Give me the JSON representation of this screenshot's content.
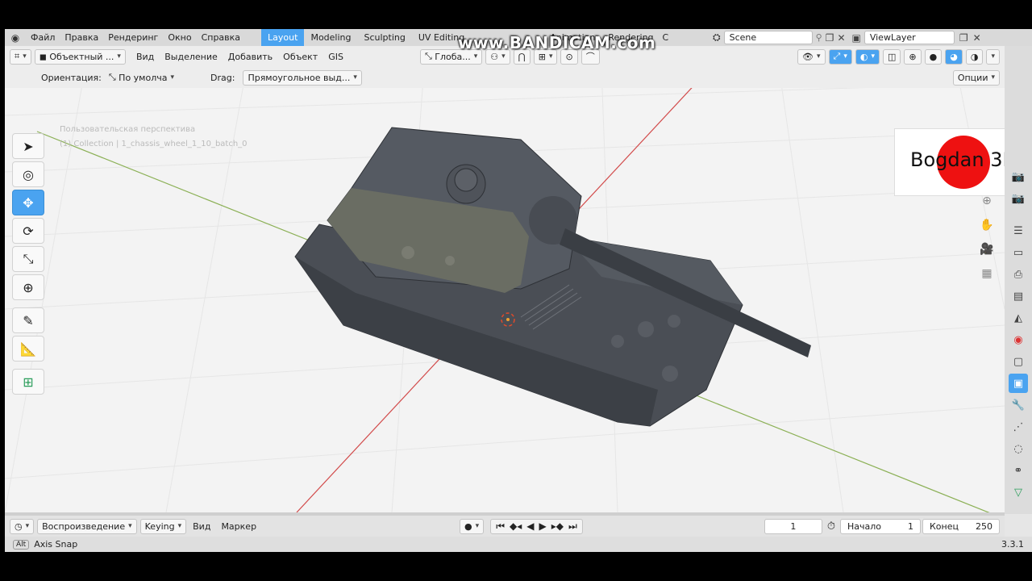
{
  "menu": {
    "items": [
      "Файл",
      "Правка",
      "Рендеринг",
      "Окно",
      "Справка"
    ]
  },
  "workspaces": {
    "tabs": [
      "Layout",
      "Modeling",
      "Sculpting",
      "UV Editing",
      "Animation",
      "Rendering",
      "C"
    ],
    "active": "Layout"
  },
  "scene": {
    "name": "Scene",
    "view_layer": "ViewLayer"
  },
  "header": {
    "mode": "Объектный ...",
    "menus": [
      "Вид",
      "Выделение",
      "Добавить",
      "Объект",
      "GIS"
    ],
    "transform_orientation": "Глоба..."
  },
  "tool_settings": {
    "orientation_label": "Ориентация:",
    "orientation_value": "По умолча",
    "drag_label": "Drag:",
    "drag_value": "Прямоугольное выд...",
    "options": "Опции"
  },
  "viewport": {
    "perspective_text": "Пользовательская перспектива",
    "collection_text": "(1) Collection | 1_chassis_wheel_1_10_batch_0"
  },
  "watermark": {
    "text": "Bogdan 3D",
    "circle_color": "#ee1111"
  },
  "recorder_watermark": "www.BANDICAM.com",
  "timeline": {
    "playback": "Воспроизведение",
    "keying": "Keying",
    "view": "Вид",
    "marker": "Маркер",
    "current_frame": "1",
    "start_label": "Начало",
    "start_value": "1",
    "end_label": "Конец",
    "end_value": "250"
  },
  "status": {
    "key": "Alt",
    "text": "Axis Snap",
    "version": "3.3.1"
  },
  "colors": {
    "accent": "#4aa3f0",
    "axis_x": "#d24a4a",
    "axis_y": "#8bb055"
  }
}
